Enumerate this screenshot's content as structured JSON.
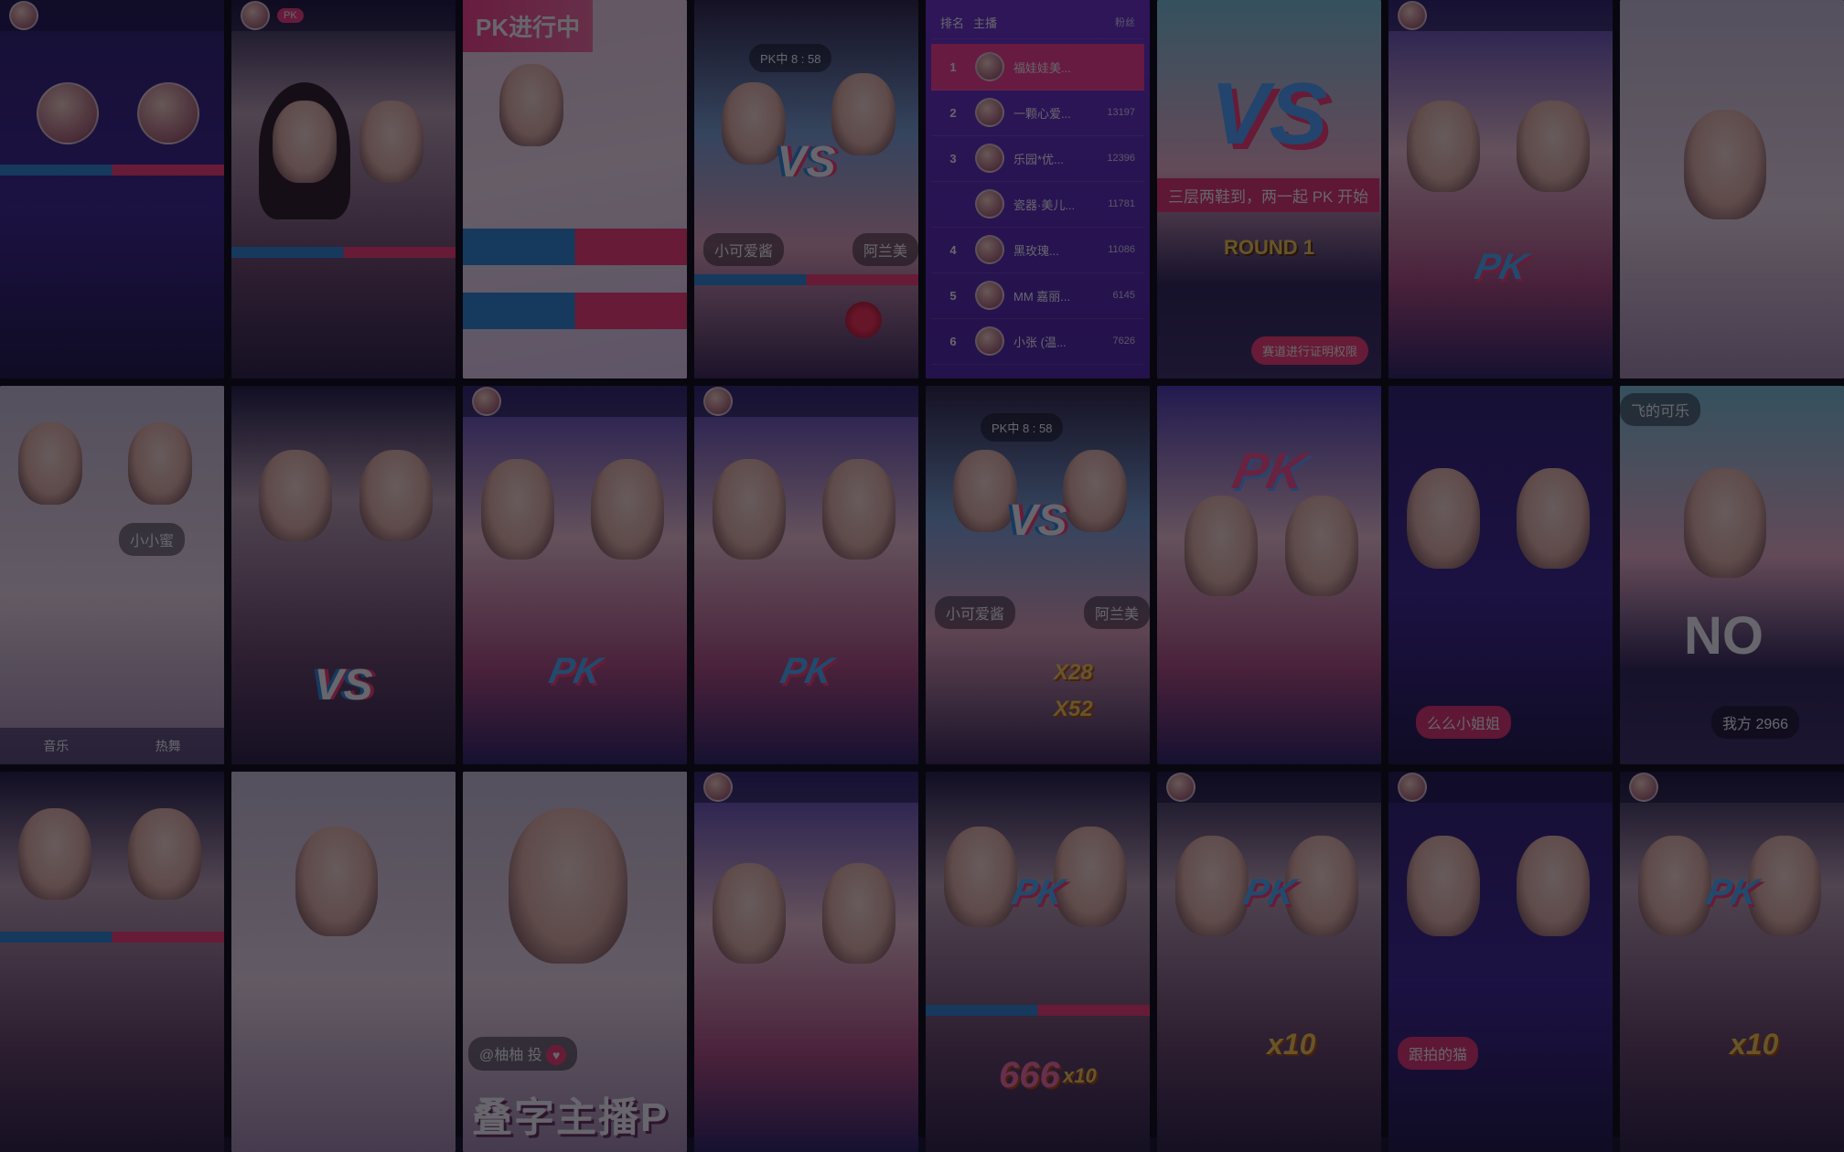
{
  "tiles": {
    "r1c1": {
      "title": ""
    },
    "r1c2": {
      "badge": "PK"
    },
    "r1c3": {
      "title": "PK进行中"
    },
    "r1c4": {
      "timer": "PK中 8 : 58",
      "name_left": "小可爱酱",
      "name_right": "阿兰美"
    },
    "r1c5": {
      "header_left": "排名",
      "header_mid": "主播",
      "header_right": "粉丝",
      "rows": [
        {
          "rank": "1",
          "name": "福娃娃美...",
          "score": ""
        },
        {
          "rank": "2",
          "name": "一颗心爱...",
          "score": "13197"
        },
        {
          "rank": "3",
          "name": "乐园*优...",
          "score": "12396"
        },
        {
          "rank": "",
          "name": "瓷器·美儿...",
          "score": "11781"
        },
        {
          "rank": "4",
          "name": "黑玫瑰...",
          "score": "11086"
        },
        {
          "rank": "5",
          "name": "MM 嘉丽...",
          "score": "6145"
        },
        {
          "rank": "6",
          "name": "小张 (温...",
          "score": "7626"
        }
      ]
    },
    "r1c6": {
      "vs": "VS",
      "banner": "三层两鞋到，两一起 PK 开始",
      "round": "ROUND 1",
      "cta": "赛道进行证明权限"
    },
    "r1c7": {
      "pk": "PK"
    },
    "r1c8": {},
    "r2c1": {
      "name": "小小蜜",
      "nav": [
        "音乐",
        "热舞"
      ]
    },
    "r2c2": {
      "vs": "VS"
    },
    "r2c3": {
      "pk": "PK"
    },
    "r2c4": {
      "pk": "PK"
    },
    "r2c5": {
      "timer": "PK中 8 : 58",
      "vs": "VS",
      "name_left": "小可爱酱",
      "name_right": "阿兰美",
      "mult1": "X28",
      "mult2": "X52"
    },
    "r2c6": {
      "pk": "PK"
    },
    "r2c7": {
      "name": "么么小姐姐"
    },
    "r2c8": {
      "title": "飞的可乐",
      "shirt": "NO",
      "name": "我方 2966"
    },
    "r3c1": {},
    "r3c2": {},
    "r3c3": {
      "handle": "@柚柚 投",
      "big": "叠字主播P"
    },
    "r3c4": {},
    "r3c5": {
      "pk": "PK",
      "gift": "666",
      "mult": "x10"
    },
    "r3c6": {
      "pk": "PK",
      "mult": "x10"
    },
    "r3c7": {
      "name": "跟拍的猫"
    },
    "r3c8": {
      "pk": "PK",
      "mult": "x10"
    }
  }
}
